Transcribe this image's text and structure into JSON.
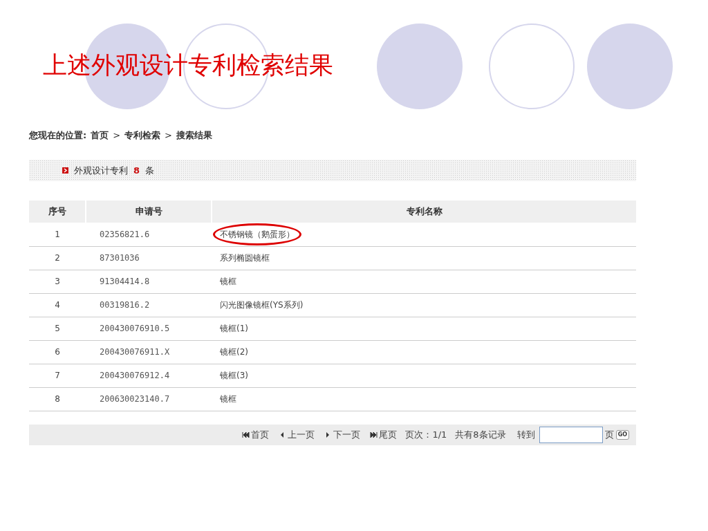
{
  "slide_title": "上述外观设计专利检索结果",
  "breadcrumb": {
    "label": "您现在的位置:",
    "items": [
      "首页",
      "专利检索",
      "搜索结果"
    ],
    "separator": ">"
  },
  "result_bar": {
    "label": "外观设计专利",
    "count": "8",
    "unit": "条"
  },
  "table": {
    "columns": [
      "序号",
      "申请号",
      "专利名称"
    ],
    "rows": [
      {
        "no": "1",
        "application": "02356821.6",
        "name": "不锈钢镜（鹅蛋形）",
        "circled": true
      },
      {
        "no": "2",
        "application": "87301036",
        "name": "系列椭圆镜框",
        "circled": false
      },
      {
        "no": "3",
        "application": "91304414.8",
        "name": "镜框",
        "circled": false
      },
      {
        "no": "4",
        "application": "00319816.2",
        "name": "闪光图像镜框(YS系列)",
        "circled": false
      },
      {
        "no": "5",
        "application": "200430076910.5",
        "name": "镜框(1)",
        "circled": false
      },
      {
        "no": "6",
        "application": "200430076911.X",
        "name": "镜框(2)",
        "circled": false
      },
      {
        "no": "7",
        "application": "200430076912.4",
        "name": "镜框(3)",
        "circled": false
      },
      {
        "no": "8",
        "application": "200630023140.7",
        "name": "镜框",
        "circled": false
      }
    ]
  },
  "pager": {
    "links": [
      {
        "kind": "first",
        "label": "首页"
      },
      {
        "kind": "prev",
        "label": "上一页"
      },
      {
        "kind": "next",
        "label": "下一页"
      },
      {
        "kind": "last",
        "label": "尾页"
      }
    ],
    "page_info": "页次：1/1",
    "total": "共有8条记录",
    "goto_label": "转到",
    "page_unit": "页",
    "go_button": "GO"
  }
}
